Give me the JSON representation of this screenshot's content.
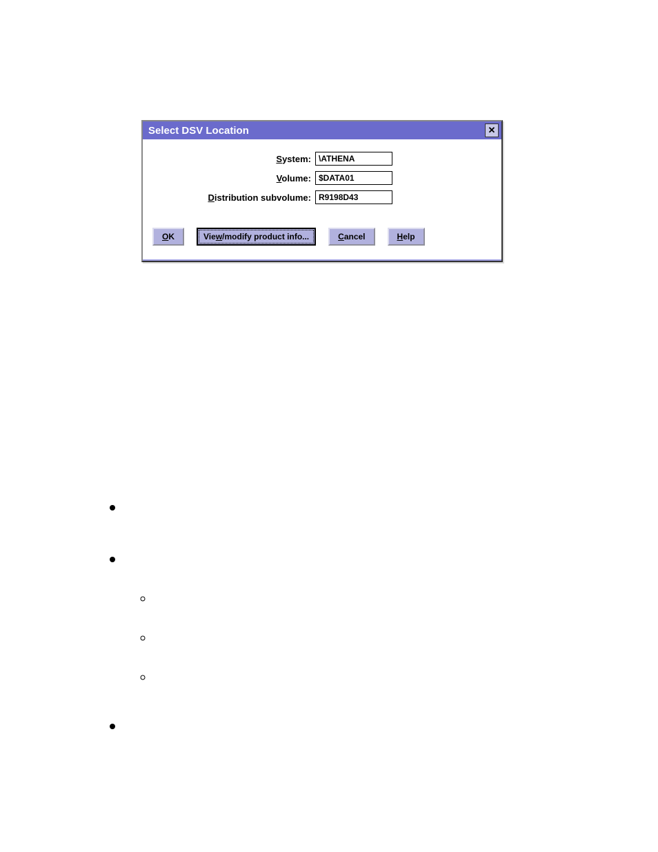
{
  "dialog": {
    "title": "Select DSV Location",
    "fields": {
      "system": {
        "label_pre": "",
        "label_accel": "S",
        "label_post": "ystem:",
        "value": "\\ATHENA"
      },
      "volume": {
        "label_pre": "",
        "label_accel": "V",
        "label_post": "olume:",
        "value": "$DATA01"
      },
      "distsv": {
        "label_pre": "",
        "label_accel": "D",
        "label_post": "istribution subvolume:",
        "value": "R9198D43"
      }
    },
    "buttons": {
      "ok": {
        "pre": "",
        "accel": "O",
        "post": "K"
      },
      "view": {
        "pre": "Vie",
        "accel": "w",
        "post": "/modify product info..."
      },
      "cancel": {
        "pre": "",
        "accel": "C",
        "post": "ancel"
      },
      "help": {
        "pre": "",
        "accel": "H",
        "post": "elp"
      }
    }
  }
}
